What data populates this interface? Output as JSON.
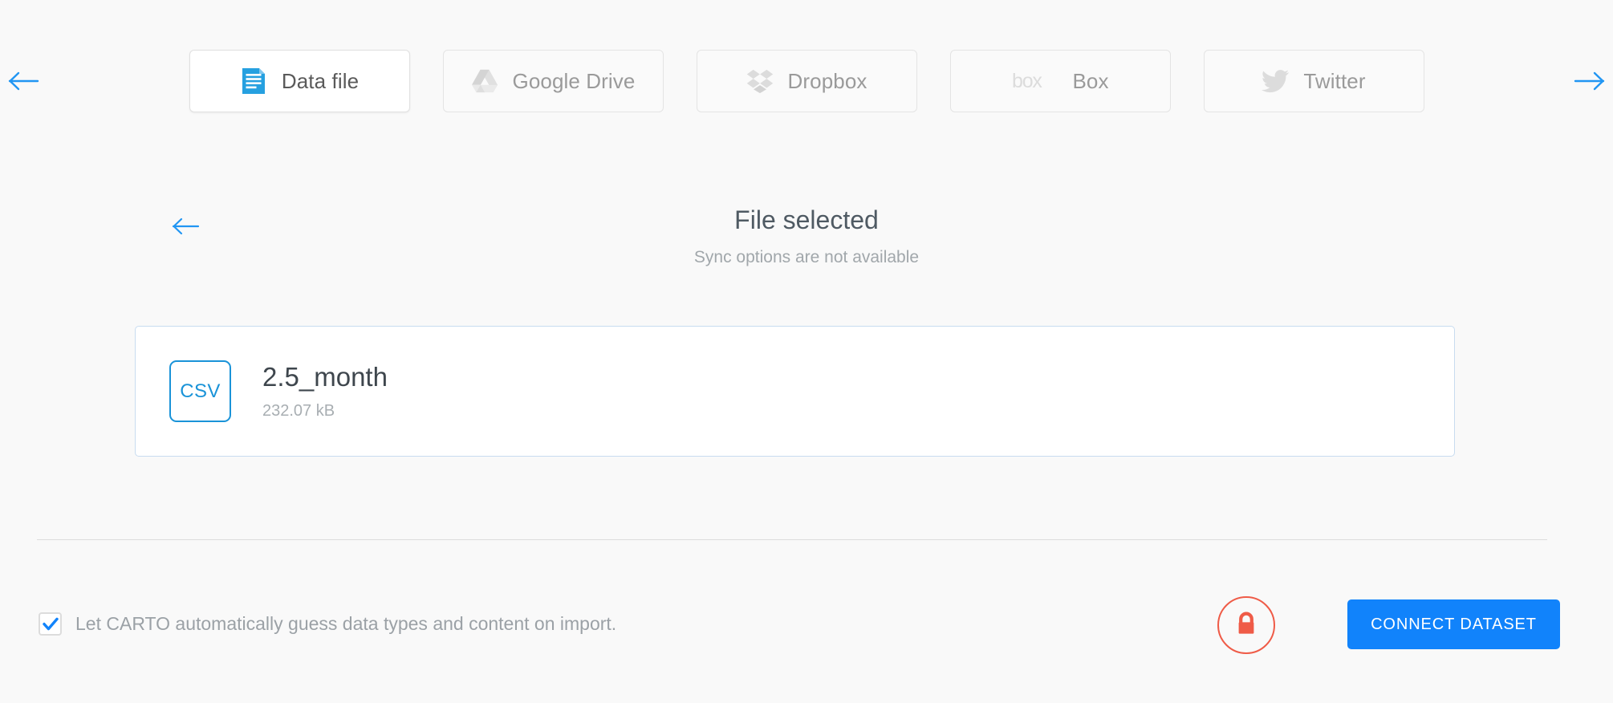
{
  "connector_tabs": {
    "prev_arrow": "left-arrow",
    "next_arrow": "right-arrow",
    "items": [
      {
        "label": "Data file",
        "icon": "data-file-icon",
        "active": true
      },
      {
        "label": "Google Drive",
        "icon": "google-drive-icon",
        "active": false
      },
      {
        "label": "Dropbox",
        "icon": "dropbox-icon",
        "active": false
      },
      {
        "label": "Box",
        "icon": "box-icon",
        "active": false
      },
      {
        "label": "Twitter",
        "icon": "twitter-icon",
        "active": false
      }
    ]
  },
  "panel": {
    "back_label": "back-arrow",
    "title": "File selected",
    "subtitle": "Sync options are not available"
  },
  "file": {
    "type_badge": "CSV",
    "name": "2.5_month",
    "size": "232.07 kB"
  },
  "footer": {
    "guess_checkbox_checked": true,
    "guess_label": "Let CARTO automatically guess data types and content on import.",
    "lock_icon": "lock-icon",
    "connect_label": "CONNECT DATASET"
  },
  "colors": {
    "page_background": "#f9f9f9",
    "accent_blue": "#1183fb",
    "link_blue": "#2196f3",
    "csv_blue": "#1a93d8",
    "card_border": "#c8dcf0",
    "lock_red": "#ef5b47",
    "title_text": "#4f5a63",
    "muted_text": "#a1a7ab"
  }
}
